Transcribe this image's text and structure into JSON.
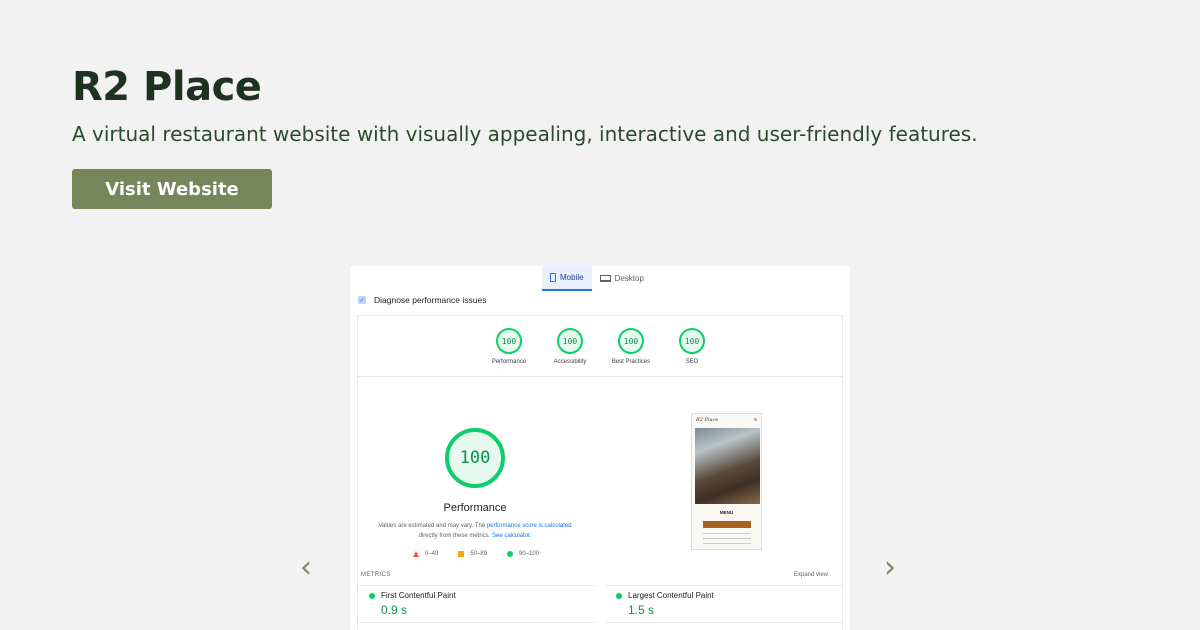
{
  "hero": {
    "title": "R2 Place",
    "subtitle": "A virtual restaurant website with visually appealing, interactive and user-friendly features.",
    "button_label": "Visit Website"
  },
  "carousel": {
    "prev_icon": "‹",
    "next_icon": "›"
  },
  "report": {
    "tabs": [
      {
        "label": "Mobile",
        "icon": "phone-icon",
        "active": true
      },
      {
        "label": "Desktop",
        "icon": "laptop-icon",
        "active": false
      }
    ],
    "diagnose_label": "Diagnose performance issues",
    "categories": [
      {
        "score": "100",
        "label": "Performance"
      },
      {
        "score": "100",
        "label": "Accessibility"
      },
      {
        "score": "100",
        "label": "Best Practices"
      },
      {
        "score": "100",
        "label": "SEO"
      }
    ],
    "main_score": "100",
    "main_label": "Performance",
    "note_text": "Values are estimated and may vary. The",
    "note_link1": "performance score is calculated",
    "note_text2": "directly from these metrics.",
    "note_link2": "See calculator.",
    "legend": [
      {
        "range": "0–49",
        "color": "#ff4e42"
      },
      {
        "range": "50–89",
        "color": "#ffa400"
      },
      {
        "range": "90–100",
        "color": "#0cce6b"
      }
    ],
    "preview": {
      "site_title": "R2 Place",
      "menu_icon": "≡",
      "heading": "MENU"
    },
    "metrics_label": "METRICS",
    "expand_label": "Expand view",
    "metrics": [
      {
        "name": "First Contentful Paint",
        "value": "0.9 s"
      },
      {
        "name": "Largest Contentful Paint",
        "value": "1.5 s"
      }
    ]
  },
  "colors": {
    "accent": "#76855a",
    "pass": "#0cce6b",
    "title": "#1d3320"
  }
}
